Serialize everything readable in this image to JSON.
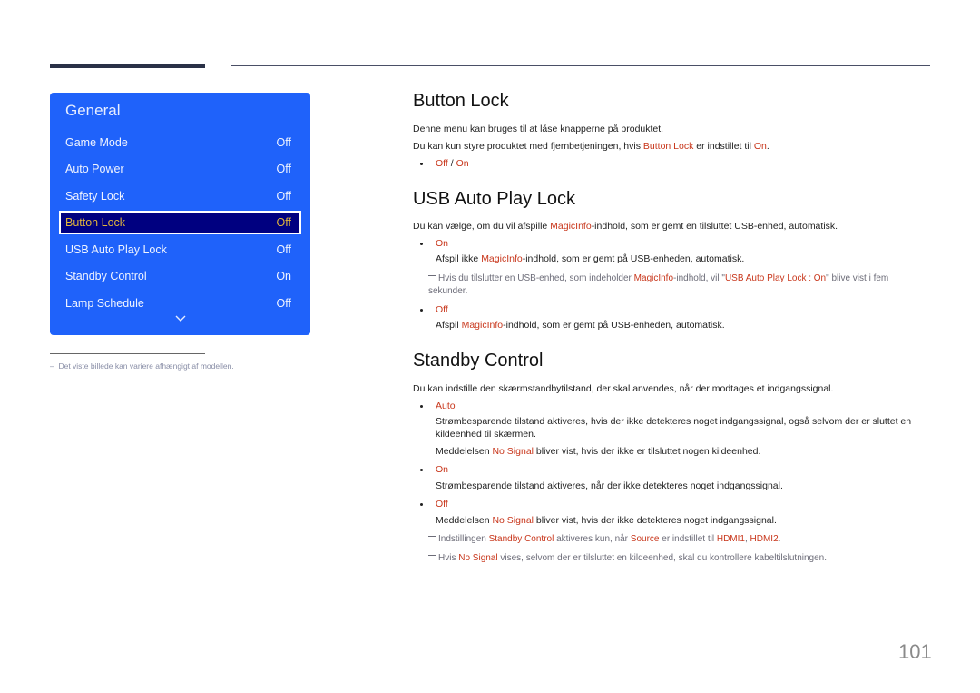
{
  "menu": {
    "title": "General",
    "items": [
      {
        "label": "Game Mode",
        "value": "Off",
        "selected": false
      },
      {
        "label": "Auto Power",
        "value": "Off",
        "selected": false
      },
      {
        "label": "Safety Lock",
        "value": "Off",
        "selected": false
      },
      {
        "label": "Button Lock",
        "value": "Off",
        "selected": true
      },
      {
        "label": "USB Auto Play Lock",
        "value": "Off",
        "selected": false
      },
      {
        "label": "Standby Control",
        "value": "On",
        "selected": false
      },
      {
        "label": "Lamp Schedule",
        "value": "Off",
        "selected": false
      }
    ],
    "more_icon": "chevron-down-icon"
  },
  "footnote": "Det viste billede kan variere afhængigt af modellen.",
  "sections": {
    "button_lock": {
      "title": "Button Lock",
      "p1": "Denne menu kan bruges til at låse knapperne på produktet.",
      "p2_a": "Du kan kun styre produktet med fjernbetjeningen, hvis ",
      "p2_b": "Button Lock",
      "p2_c": " er indstillet til ",
      "p2_d": "On",
      "p2_e": ".",
      "opt_off": "Off",
      "opt_sep": " / ",
      "opt_on": "On"
    },
    "usb_auto_play_lock": {
      "title": "USB Auto Play Lock",
      "p1_a": "Du kan vælge, om du vil afspille ",
      "p1_b": "MagicInfo",
      "p1_c": "-indhold, som er gemt en tilsluttet USB-enhed, automatisk.",
      "on_label": "On",
      "on_a": "Afspil ikke ",
      "on_b": "MagicInfo",
      "on_c": "-indhold, som er gemt på USB-enheden, automatisk.",
      "note_a": "Hvis du tilslutter en USB-enhed, som indeholder ",
      "note_b": "MagicInfo",
      "note_c": "-indhold, vil \"",
      "note_d": "USB Auto Play Lock : On",
      "note_e": "\" blive vist i fem sekunder.",
      "off_label": "Off",
      "off_a": "Afspil ",
      "off_b": "MagicInfo",
      "off_c": "-indhold, som er gemt på USB-enheden, automatisk."
    },
    "standby_control": {
      "title": "Standby Control",
      "p1": "Du kan indstille den skærmstandbytilstand, der skal anvendes, når der modtages et indgangssignal.",
      "auto_label": "Auto",
      "auto_desc": "Strømbesparende tilstand aktiveres, hvis der ikke detekteres noget indgangssignal, også selvom der er sluttet en kildeenhed til skærmen.",
      "auto_msg_a": "Meddelelsen ",
      "auto_msg_b": "No Signal",
      "auto_msg_c": " bliver vist, hvis der ikke er tilsluttet nogen kildeenhed.",
      "on_label": "On",
      "on_desc": "Strømbesparende tilstand aktiveres, når der ikke detekteres noget indgangssignal.",
      "off_label": "Off",
      "off_a": "Meddelelsen ",
      "off_b": "No Signal",
      "off_c": " bliver vist, hvis der ikke detekteres noget indgangssignal.",
      "note1_a": "Indstillingen ",
      "note1_b": "Standby Control",
      "note1_c": " aktiveres kun, når ",
      "note1_d": "Source",
      "note1_e": " er indstillet til ",
      "note1_f": "HDMI1",
      "note1_g": ", ",
      "note1_h": "HDMI2",
      "note1_i": ".",
      "note2_a": "Hvis ",
      "note2_b": "No Signal",
      "note2_c": " vises, selvom der er tilsluttet en kildeenhed, skal du kontrollere kabeltilslutningen."
    }
  },
  "page_number": "101"
}
